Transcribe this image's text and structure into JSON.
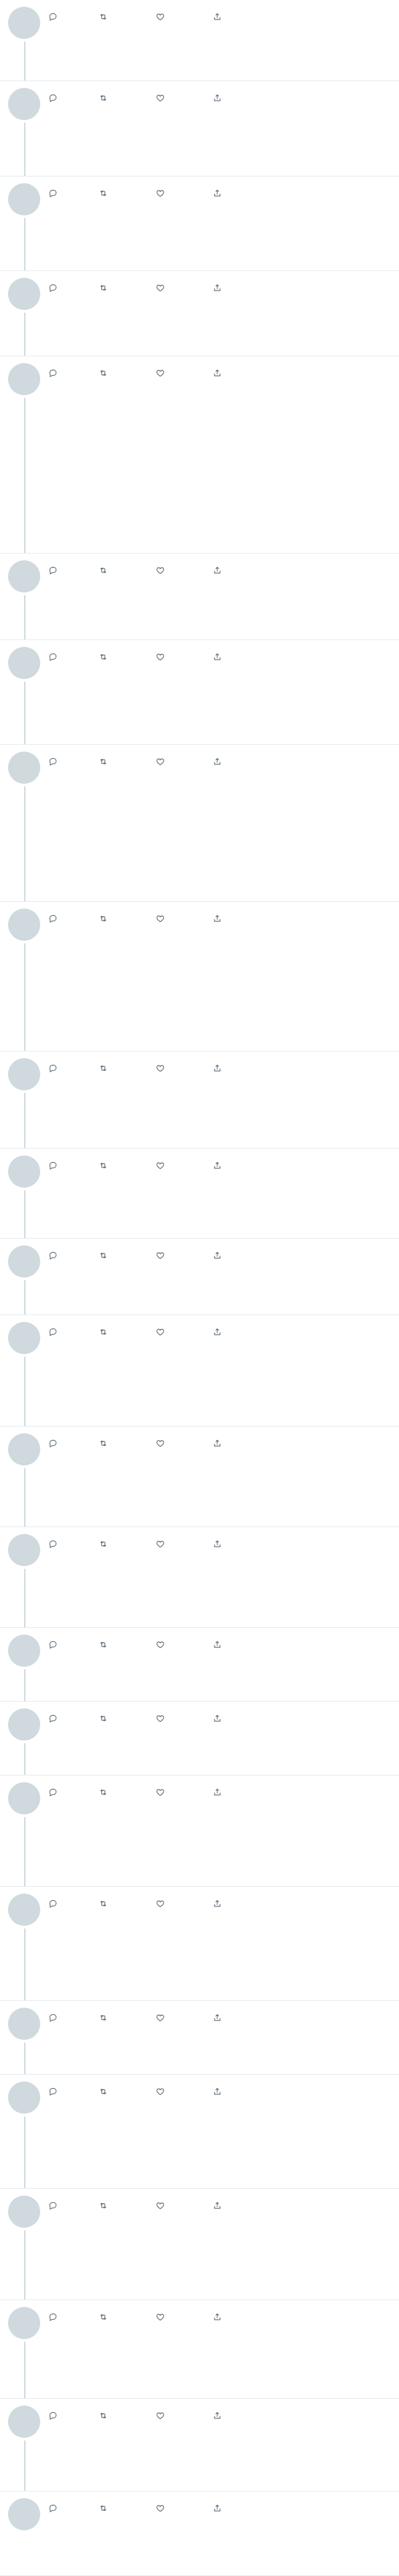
{
  "colors": {
    "text": "#0f1419",
    "secondary": "#536471",
    "divider": "#e6ecf0",
    "thread_line": "#cfd9de"
  },
  "tweets": []
}
